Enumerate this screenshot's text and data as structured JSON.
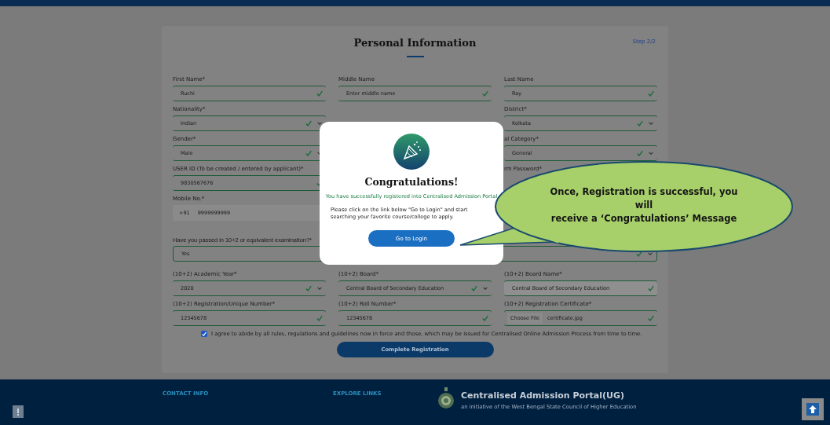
{
  "form": {
    "title": "Personal Information",
    "step": "Step 2/2",
    "rows_top": [
      {
        "col_1": {
          "label": "First Name*",
          "value": "Ruchi",
          "kind": "text",
          "valid": true
        },
        "col_2": {
          "label": "Middle Name",
          "value": "Enter middle name",
          "kind": "text",
          "valid": true
        },
        "col_3": {
          "label": "Last Name",
          "value": "Ray",
          "kind": "text",
          "valid": true
        }
      },
      {
        "col_1": {
          "label": "Nationality*",
          "value": "Indian",
          "kind": "select",
          "valid": true
        },
        "col_3": {
          "label": "District*",
          "value": "Kolkata",
          "kind": "select",
          "valid": true
        }
      },
      {
        "col_1": {
          "label": "Gender*",
          "value": "Male",
          "kind": "select",
          "valid": true
        },
        "col_3": {
          "label": "al Category*",
          "value": "General",
          "kind": "select",
          "valid": true
        }
      },
      {
        "col_1": {
          "label": "USER ID (To be created / entered by applicant)*",
          "value": "9830567676",
          "kind": "text",
          "valid": true
        },
        "col_3": {
          "label": "rm Password*"
        }
      },
      {
        "col_1": {
          "label": "Mobile No.*",
          "prefix": "+91",
          "value": "9999999999",
          "kind": "phone",
          "valid": false
        }
      }
    ],
    "exam": {
      "label": "Have you passed in 10+2 or equivalent examination?*",
      "value": "Yes",
      "kind": "select",
      "valid": true
    },
    "rows_bottom": [
      {
        "col_1": {
          "label": "(10+2) Academic Year*",
          "value": "2020",
          "kind": "select",
          "valid": true
        },
        "col_2": {
          "label": "(10+2) Board*",
          "value": "Central Board of Secondary Education",
          "kind": "select",
          "valid": true
        },
        "col_3": {
          "label": "(10+2) Board Name*",
          "value": "Central Board of Secondary Education",
          "kind": "disabled",
          "valid": true
        }
      },
      {
        "col_1": {
          "label": "(10+2) Registration/Unique Number*",
          "value": "12345678",
          "kind": "text",
          "valid": true
        },
        "col_2": {
          "label": "(10+2) Roll Number*",
          "value": "12345678",
          "kind": "text",
          "valid": true
        },
        "col_3": {
          "label": "(10+2) Registration Certificate*",
          "prefix": "Choose File",
          "value": "certificate.jpg",
          "kind": "file",
          "valid": true
        }
      }
    ],
    "agree": {
      "checked": true,
      "text": "I agree to abide by all rules, regulations and guidelines now in force and those, which may be issued for Centralised Online Admission Process from time to time."
    },
    "submit": "Complete Registration"
  },
  "modal": {
    "title": "Congratulations!",
    "success": "You have successfully registered into Centralised Admission Portal",
    "body": "Please click on the link below \"Go to Login\" and start searching your favorite course/college to apply.",
    "button": "Go to Login"
  },
  "callout": {
    "lines": [
      "Once, Registration is successful, you",
      "will",
      "receive a ‘Congratulations’ Message"
    ]
  },
  "footer": {
    "contact": "CONTACT INFO",
    "explore": "EXPLORE LINKS",
    "portal": "Centralised Admission Portal(UG)",
    "tagline": "an initiative of the West Bengal State Council of Higher Education"
  }
}
